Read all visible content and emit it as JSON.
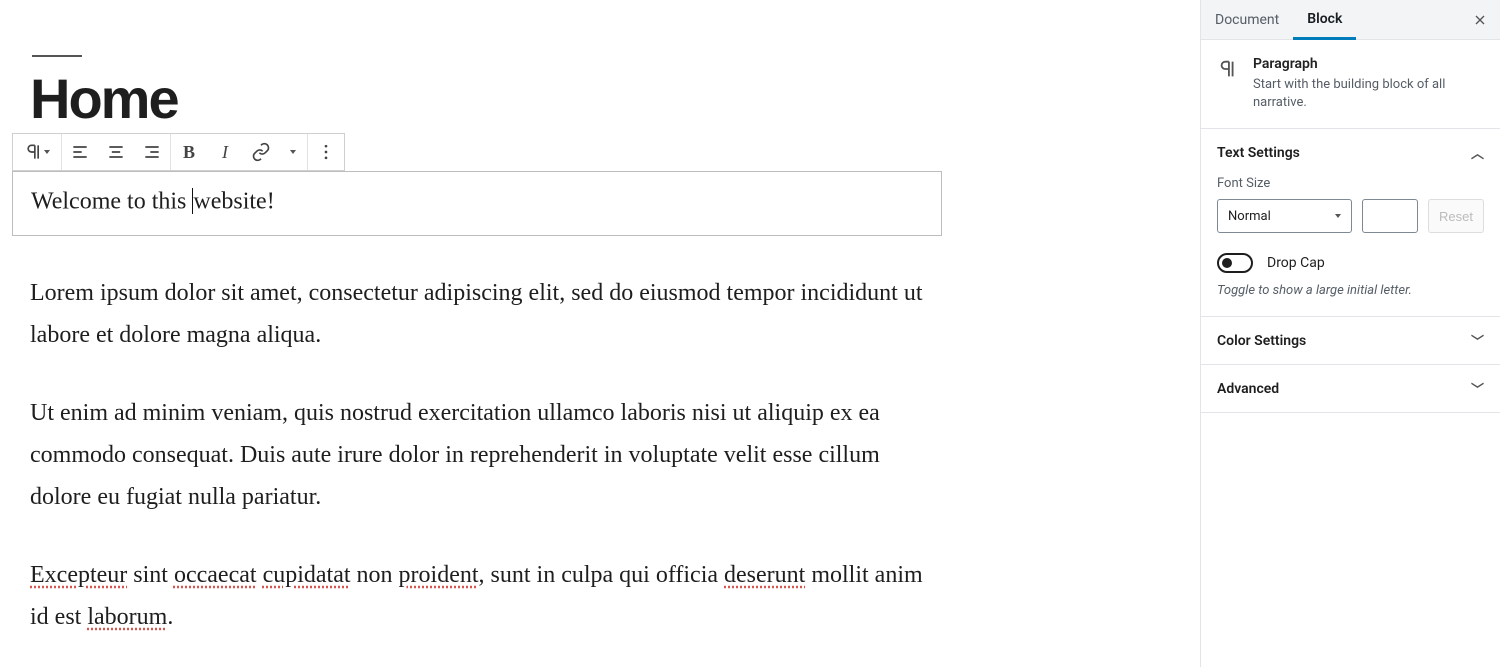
{
  "editor": {
    "page_title": "Home",
    "toolbar": {
      "block_type_icon": "pilcrow-icon",
      "align_left_icon": "align-left-icon",
      "align_center_icon": "align-center-icon",
      "align_right_icon": "align-right-icon",
      "bold_label": "B",
      "italic_label": "I",
      "link_icon": "link-icon",
      "more_icon": "more-icon"
    },
    "selected_block": {
      "text_before_cursor": "Welcome to this ",
      "text_after_cursor": "website!"
    },
    "paragraphs": [
      "Lorem ipsum dolor sit amet, consectetur adipiscing elit, sed do eiusmod tempor incididunt ut labore et dolore magna aliqua.",
      "Ut enim ad minim veniam, quis nostrud exercitation ullamco laboris nisi ut aliquip ex ea commodo consequat. Duis aute irure dolor in reprehenderit in voluptate velit esse cillum dolore eu fugiat nulla pariatur."
    ],
    "paragraph3_parts": {
      "w1": "Excepteur",
      "t1": " sint ",
      "w2": "occaecat",
      "t2": " ",
      "w3": "cupidatat",
      "t3": " non ",
      "w4": "proident",
      "t4": ", sunt in culpa qui officia ",
      "w5": "deserunt",
      "t5": " mollit anim id est ",
      "w6": "laborum",
      "t6": "."
    }
  },
  "sidebar": {
    "tabs": {
      "document": "Document",
      "block": "Block"
    },
    "block_info": {
      "title": "Paragraph",
      "description": "Start with the building block of all narrative."
    },
    "text_settings": {
      "title": "Text Settings",
      "font_size_label": "Font Size",
      "font_size_value": "Normal",
      "reset_label": "Reset",
      "drop_cap_label": "Drop Cap",
      "drop_cap_hint": "Toggle to show a large initial letter."
    },
    "color_settings": {
      "title": "Color Settings"
    },
    "advanced": {
      "title": "Advanced"
    }
  }
}
